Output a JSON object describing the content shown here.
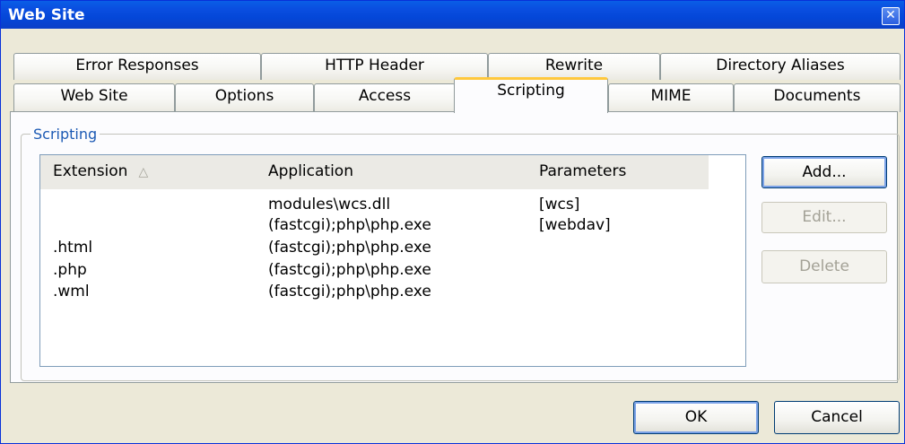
{
  "window": {
    "title": "Web Site"
  },
  "tabs_row1": [
    {
      "label": "Error Responses"
    },
    {
      "label": "HTTP Header"
    },
    {
      "label": "Rewrite"
    },
    {
      "label": "Directory Aliases"
    }
  ],
  "tabs_row2": [
    {
      "label": "Web Site"
    },
    {
      "label": "Options"
    },
    {
      "label": "Access"
    },
    {
      "label": "Scripting",
      "active": true
    },
    {
      "label": "MIME"
    },
    {
      "label": "Documents"
    }
  ],
  "group": {
    "label": "Scripting"
  },
  "list": {
    "columns": [
      "Extension",
      "Application",
      "Parameters"
    ],
    "sort_indicator": "△",
    "rows": [
      {
        "extension": "",
        "application": "modules\\wcs.dll",
        "parameters": "[wcs]"
      },
      {
        "extension": "",
        "application": "(fastcgi);php\\php.exe",
        "parameters": "[webdav]"
      },
      {
        "extension": ".html",
        "application": "(fastcgi);php\\php.exe",
        "parameters": ""
      },
      {
        "extension": ".php",
        "application": "(fastcgi);php\\php.exe",
        "parameters": ""
      },
      {
        "extension": ".wml",
        "application": "(fastcgi);php\\php.exe",
        "parameters": ""
      }
    ]
  },
  "side_buttons": {
    "add": "Add...",
    "edit": "Edit...",
    "delete": "Delete"
  },
  "footer": {
    "ok": "OK",
    "cancel": "Cancel"
  },
  "colors": {
    "titlebar": "#0a4ee0",
    "active_tab_accent": "#ffc83c",
    "group_label": "#1c5ab4",
    "dialog_bg": "#ece9d8"
  }
}
